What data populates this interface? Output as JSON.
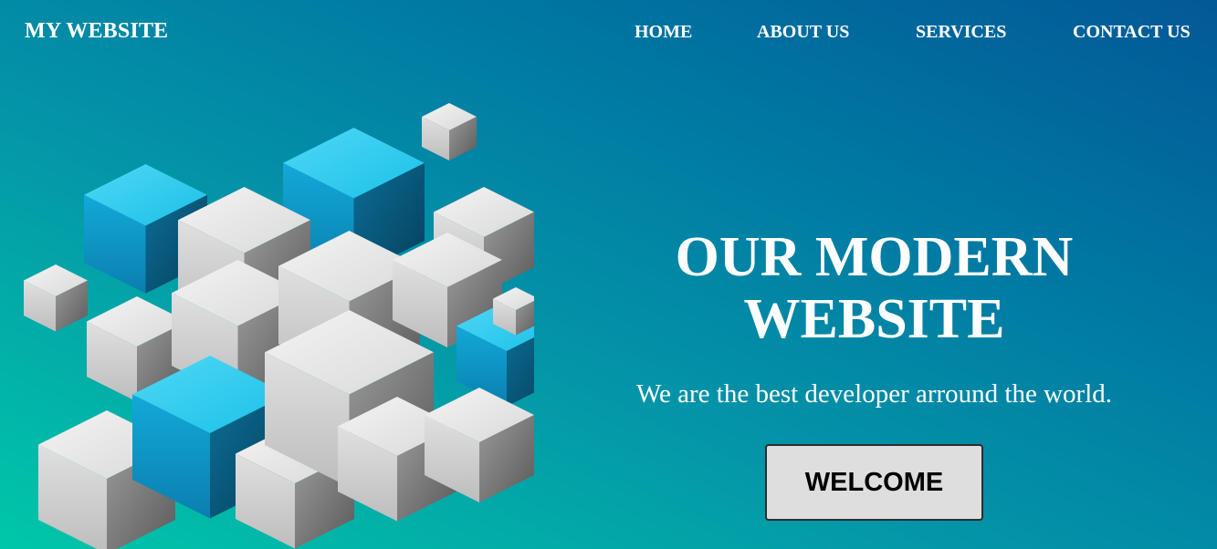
{
  "navbar": {
    "brand": "MY WEBSITE",
    "links": [
      {
        "label": "HOME"
      },
      {
        "label": "ABOUT US"
      },
      {
        "label": "SERVICES"
      },
      {
        "label": "CONTACT US"
      }
    ]
  },
  "hero": {
    "title_line1": "OUR MODERN",
    "title_line2": "WEBSITE",
    "subtitle": "We are the best developer arround the world.",
    "button_label": "WELCOME",
    "illustration": "cubes-illustration"
  },
  "colors": {
    "gradient_top_right": "#035896",
    "gradient_bottom_left": "#00c7a9",
    "cube_blue": "#14b8e0",
    "cube_grey": "#e2e2e2",
    "button_bg": "#dedede"
  }
}
